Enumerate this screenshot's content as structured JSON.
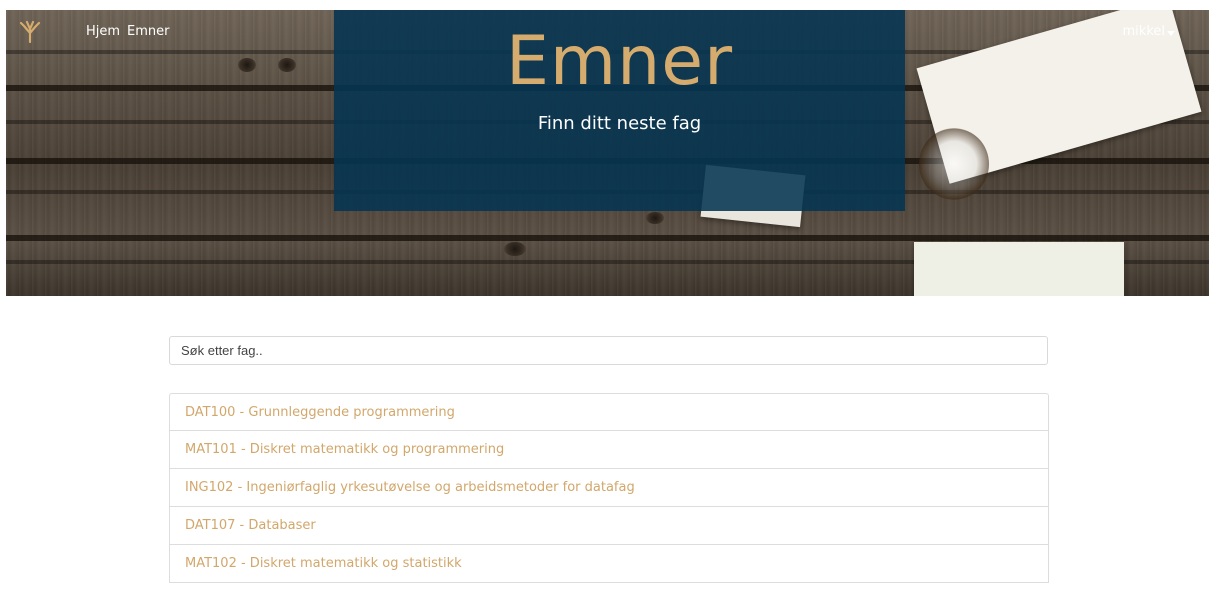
{
  "header": {
    "title": "Emner",
    "subtitle": "Finn ditt neste fag"
  },
  "nav": {
    "logo_icon": "yggdrasil-tree-icon",
    "links": [
      "Hjem",
      "Emner"
    ],
    "user": "mikkel"
  },
  "search": {
    "placeholder": "Søk etter fag.."
  },
  "courses": [
    "DAT100 - Grunnleggende programmering",
    "MAT101 - Diskret matematikk og programmering",
    "ING102 - Ingeniørfaglig yrkesutøvelse og arbeidsmetoder for datafag",
    "DAT107 - Databaser",
    "MAT102 - Diskret matematikk og statistikk"
  ],
  "colors": {
    "accent": "#d6ab6e",
    "overlay": "#043452",
    "link": "#d2a76b"
  }
}
